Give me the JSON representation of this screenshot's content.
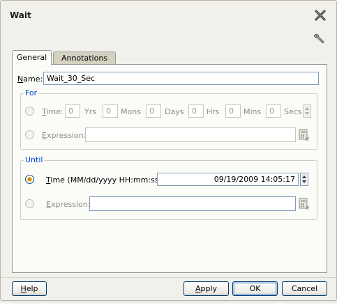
{
  "dialog": {
    "title": "Wait",
    "close_icon": "close-icon",
    "wrench_icon": "wrench-icon"
  },
  "tabs": [
    {
      "label": "General",
      "active": true
    },
    {
      "label": "Annotations",
      "active": false
    }
  ],
  "name": {
    "label_mnemonic": "N",
    "label_rest": "ame:",
    "value": "Wait_30_Sec"
  },
  "for_group": {
    "title": "For",
    "time": {
      "label_mnemonic": "T",
      "label_rest": "ime:",
      "fields": [
        {
          "value": "0",
          "unit": "Yrs"
        },
        {
          "value": "0",
          "unit": "Mons"
        },
        {
          "value": "0",
          "unit": "Days"
        },
        {
          "value": "0",
          "unit": "Hrs"
        },
        {
          "value": "0",
          "unit": "Mins"
        },
        {
          "value": "0",
          "unit": "Secs"
        }
      ],
      "selected": false
    },
    "expression": {
      "label_mnemonic": "E",
      "label_rest": "xpression:",
      "value": "",
      "selected": false
    }
  },
  "until_group": {
    "title": "Until",
    "time": {
      "label_mnemonic": "T",
      "label_rest": "ime (MM/dd/yyyy HH:mm:ss):",
      "value": "09/19/2009 14:05:17",
      "selected": true
    },
    "expression": {
      "label_mnemonic": "E",
      "label_rest": "xpression:",
      "value": "",
      "selected": false
    }
  },
  "buttons": {
    "help_mnemonic": "H",
    "help_rest": "elp",
    "apply_mnemonic": "A",
    "apply_rest": "pply",
    "ok": "OK",
    "cancel": "Cancel"
  },
  "colors": {
    "group_title": "#0046d5",
    "dialog_bg": "#f1f0ea",
    "radio_selected": "#d08b16"
  }
}
